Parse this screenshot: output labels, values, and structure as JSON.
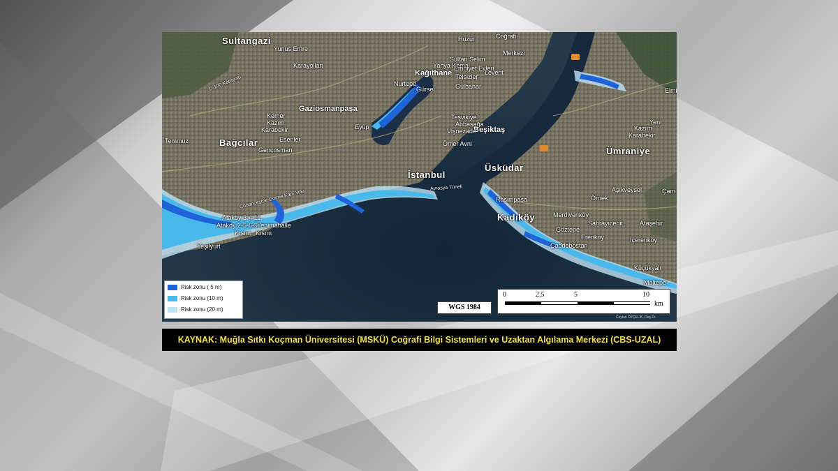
{
  "colors": {
    "risk_5m": "#1f63d8",
    "risk_10m": "#49b9ec",
    "risk_20m": "#bfe3f6",
    "caption_bg": "#000000",
    "caption_text": "#f0e23a",
    "sea": "#1c2d3b",
    "land": "#6d6b5e"
  },
  "map": {
    "places": {
      "sultangazi": "Sultangazi",
      "yunus_emre": "Yunus Emre",
      "karayollari": "Karayolları",
      "gaziosmanpasa": "Gaziosmanpaşa",
      "kemer": "Kemer",
      "kazim_karabekir_w": "Kazım",
      "karabekir_w": "Karabekir",
      "temmuz": "Temmuz",
      "bagcilar": "Bağcılar",
      "esenler": "Esenler",
      "gencosman": "Gençosman",
      "eyup": "Eyüp",
      "nurtepe": "Nurtepe",
      "gursel": "Gürsel",
      "kagithane": "Kağıthane",
      "yahya_kemal": "Yahya Kemal",
      "sultan_selim": "Sultan Selim",
      "emniyet_evleri": "Emniyet Evleri",
      "levent": "Levent",
      "telsizler": "Telsizler",
      "gulbahar": "Gülbahar",
      "huzur": "Huzur",
      "cografi": "Coğrafi",
      "merkezi": "Merkezi",
      "tesvikiye": "Teşvikiye",
      "abbasaga": "Abbasağa",
      "besiktas": "Beşiktaş",
      "visnezade": "Vişnezade",
      "omer_avni": "Ömer Avni",
      "istanbul": "İstanbul",
      "uskudar": "Üsküdar",
      "umraniye": "Ümraniye",
      "kazim_karabekir_e": "Kazım",
      "karabekir_e": "Karabekir",
      "yeni": "Yeni",
      "elmi": "Elmi",
      "asikveysel": "Aşıkveysel",
      "cam": "Çam",
      "ornek": "Örnek",
      "rasimpasa": "Rasimpaşa",
      "merdivenkoy": "Merdivenköy",
      "kadikoy": "Kadıköy",
      "sahrayicedit": "Sahrayıcedit",
      "atasehir": "Ataşehir",
      "goztepe": "Göztepe",
      "erenkoy": "Erenköy",
      "caddebostan": "Caddebostan",
      "icerenkoy": "İçerenköy",
      "kucukyali": "Küçükyalı",
      "maltepe": "Maltepe",
      "atakoy_3_4_11": "Ataköy 3-4-11.",
      "atakoy_2_5_6_9": "Ataköy 2-5-6-9.",
      "yenimahalle": "Yenimahalle",
      "kisim_1": "Kısım",
      "kisim_2": "Kısım",
      "yesilyurt": "Yeşilyurt",
      "avrasya_tuneli": "Avrasya Tüneli",
      "cobancesme": "Çobançeşme-Edirne Kapı Yolu",
      "d100": "D-100 Karayolu"
    },
    "legend": [
      {
        "label": "Risk zonu ( 5 m)",
        "color": "#1f63d8"
      },
      {
        "label": "Risk zonu (10 m)",
        "color": "#49b9ec"
      },
      {
        "label": "Risk zonu (20 m)",
        "color": "#bfe3f6"
      }
    ],
    "datum": "WGS 1984",
    "scale": {
      "ticks": [
        "0",
        "2.5",
        "5",
        "10"
      ],
      "unit": "km"
    },
    "credit": "Ceylan ÖZÇELİK, Doç.Dr."
  },
  "caption": "KAYNAK: Muğla Sıtkı Koçman Üniversitesi (MSKÜ) Coğrafi Bilgi Sistemleri ve Uzaktan Algılama Merkezi (CBS-UZAL)"
}
